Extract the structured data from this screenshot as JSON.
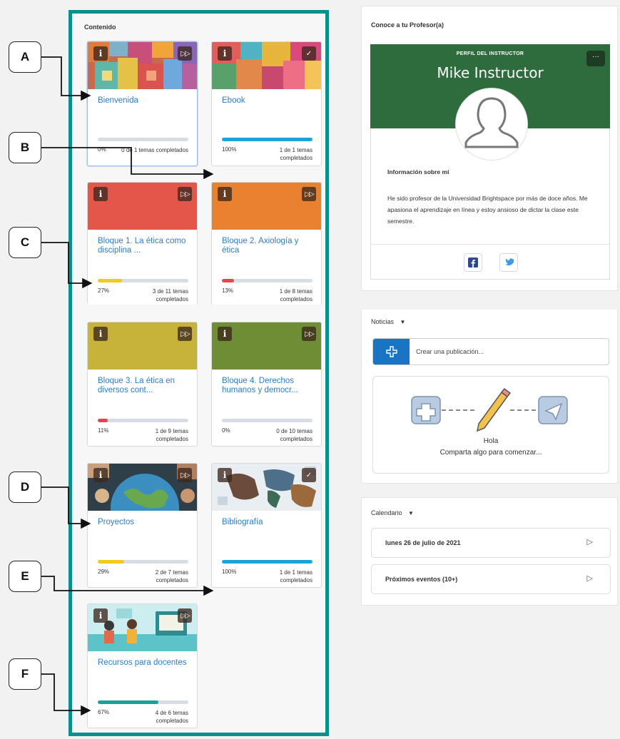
{
  "content": {
    "title": "Contenido",
    "cards": [
      {
        "title": "Bienvenida",
        "percent": "0%",
        "percent_value": 0,
        "count": "0 de 1 temas completados",
        "color": "#1aa3d9",
        "image": "colorful-cubes",
        "badge": "fast-forward",
        "selected": true
      },
      {
        "title": "Ebook",
        "percent": "100%",
        "percent_value": 100,
        "count": "1 de 1 temas completados",
        "color": "#1aa3d9",
        "image": "colorful-cubes",
        "badge": "check",
        "selected": false
      },
      {
        "title": "Bloque 1. La ética como disciplina ...",
        "percent": "27%",
        "percent_value": 27,
        "count": "3 de 11 temas completados",
        "color": "#f2c91e",
        "image": "red",
        "badge": "fast-forward",
        "selected": false
      },
      {
        "title": "Bloque 2. Axiología y ética",
        "percent": "13%",
        "percent_value": 13,
        "count": "1 de 8 temas completados",
        "color": "#e3454c",
        "image": "orange",
        "badge": "fast-forward",
        "selected": false
      },
      {
        "title": "Bloque 3. La ética en diversos cont...",
        "percent": "11%",
        "percent_value": 11,
        "count": "1 de 9 temas completados",
        "color": "#e3454c",
        "image": "mustard",
        "badge": "fast-forward",
        "selected": false
      },
      {
        "title": "Bloque 4. Derechos humanos y democr...",
        "percent": "0%",
        "percent_value": 0,
        "count": "0 de 10 temas completados",
        "color": "#1aa3d9",
        "image": "olive",
        "badge": "fast-forward",
        "selected": false
      },
      {
        "title": "Proyectos",
        "percent": "29%",
        "percent_value": 29,
        "count": "2 de 7 temas completados",
        "color": "#f2c91e",
        "image": "globe",
        "badge": "fast-forward",
        "selected": false
      },
      {
        "title": "Bibliografía",
        "percent": "100%",
        "percent_value": 100,
        "count": "1 de 1 temas completados",
        "color": "#1aa3d9",
        "image": "world-map",
        "badge": "check",
        "selected": false
      },
      {
        "title": "Recursos para docentes",
        "percent": "67%",
        "percent_value": 67,
        "count": "4 de 6 temas completados",
        "color": "#1aa19a",
        "image": "teachers",
        "badge": "fast-forward",
        "selected": false
      }
    ]
  },
  "professor": {
    "title": "Conoce a tu Profesor(a)",
    "label": "PERFIL DEL INSTRUCTOR",
    "name": "Mike Instructor",
    "more": "···",
    "info_title": "Información sobre mí",
    "info_text": "He sido profesor de la Universidad Brightspace por más de doce años. Me apasiona el aprendizaje en línea y estoy ansioso de dictar la clase este semestre.",
    "header_color": "#2e6b3d"
  },
  "news": {
    "title": "Noticias",
    "placeholder": "Crear una publicación...",
    "empty_title": "Hola",
    "empty_text": "Comparta algo para comenzar..."
  },
  "calendar": {
    "title": "Calendario",
    "rows": [
      {
        "label": "lunes 26 de julio de 2021"
      },
      {
        "label": "Próximos eventos (10+)"
      }
    ]
  },
  "callouts": [
    "A",
    "B",
    "C",
    "D",
    "E",
    "F"
  ]
}
